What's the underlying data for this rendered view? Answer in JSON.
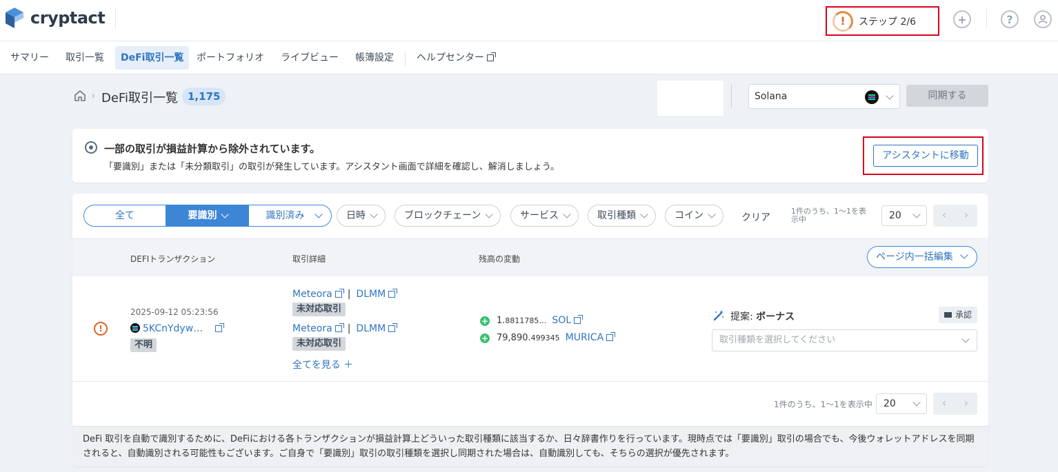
{
  "app": {
    "name": "cryptact"
  },
  "header": {
    "step_label": "ステップ 2/6",
    "icons": [
      "add-icon",
      "help-icon",
      "user-icon"
    ]
  },
  "nav": {
    "items": [
      {
        "label": "サマリー"
      },
      {
        "label": "取引一覧"
      },
      {
        "label": "DeFi取引一覧",
        "active": true
      },
      {
        "label": "ポートフォリオ"
      },
      {
        "label": "ライブビュー"
      },
      {
        "label": "帳簿設定"
      },
      {
        "label": "ヘルプセンター",
        "external": true
      }
    ]
  },
  "page": {
    "title": "DeFi取引一覧",
    "count": "1,175",
    "chain_select": "Solana",
    "sync_button": "同期する"
  },
  "alert": {
    "title": "一部の取引が損益計算から除外されています。",
    "description": "「要識別」または「未分類取引」の取引が発生しています。アシスタント画面で詳細を確認し、解消しましょう。",
    "button": "アシスタントに移動"
  },
  "filters": {
    "segments": [
      "全て",
      "要識別",
      "識別済み"
    ],
    "active_segment": "要識別",
    "pills": [
      "日時",
      "ブロックチェーン",
      "サービス",
      "取引種類",
      "コイン"
    ],
    "clear": "クリア",
    "pagination_text": "1件のうち、1〜1を表示中",
    "per_page": "20"
  },
  "table": {
    "headers": [
      "DEFIトランザクション",
      "取引詳細",
      "残高の変動"
    ],
    "bulk_edit": "ページ内一括編集",
    "rows": [
      {
        "date": "2025-09-12 05:23:56",
        "tx_hash": "5KCnYdyw…",
        "status": "不明",
        "details": [
          {
            "protocol": "Meteora",
            "pool": "DLMM",
            "tag": "未対応取引"
          },
          {
            "protocol": "Meteora",
            "pool": "DLMM",
            "tag": "未対応取引"
          }
        ],
        "see_all": "全てを見る ＋",
        "balances": [
          {
            "amount_main": "1.",
            "amount_small": "8811785…",
            "coin": "SOL"
          },
          {
            "amount_main": "79,890.",
            "amount_small": "499345",
            "coin": "MURICA"
          }
        ],
        "suggestion_label": "提案:",
        "suggestion_value": "ボーナス",
        "approve": "承認",
        "type_placeholder": "取引種類を選択してください"
      }
    ]
  },
  "bottom_pagination": {
    "text": "1件のうち、1〜1を表示中",
    "per_page": "20"
  },
  "footer_note": "DeFi 取引を自動で識別するために、DeFiにおける各トランザクションが損益計算上どういった取引種類に該当するか、日々辞書作りを行っています。現時点では「要識別」取引の場合でも、今後ウォレットアドレスを同期されると、自動識別される可能性もございます。ご自身で「要識別」取引の取引種類を選択し同期された場合は、自動識別しても、そちらの選択が優先されます。",
  "colors": {
    "accent": "#2f74c0",
    "alert_red": "#d9001b",
    "warn_orange": "#d9662a",
    "plus_green": "#3bbf72"
  }
}
